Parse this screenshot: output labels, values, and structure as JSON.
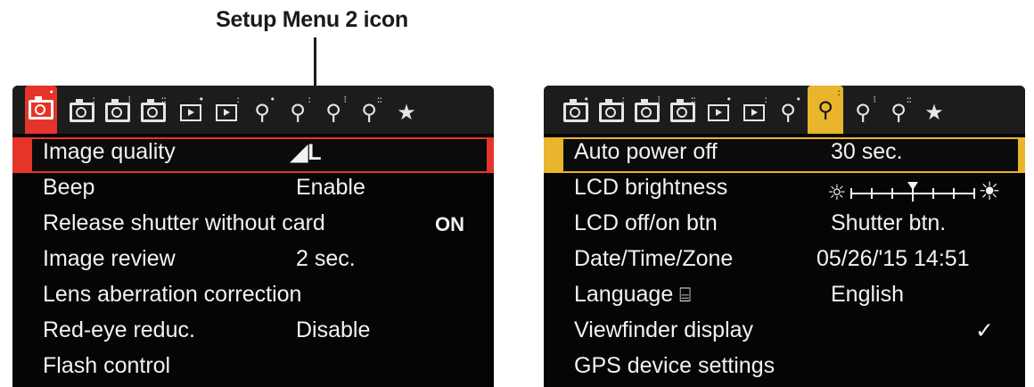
{
  "caption": "Setup Menu 2 icon",
  "colors": {
    "left_accent": "#e5342a",
    "right_accent": "#e8b52c",
    "screen_bg": "#050505",
    "text": "#f2f2f2"
  },
  "left_screen": {
    "tabs": [
      {
        "icon": "camera-icon",
        "dots": "•",
        "active": true
      },
      {
        "icon": "camera-icon",
        "dots": "••"
      },
      {
        "icon": "camera-icon",
        "dots": "•••"
      },
      {
        "icon": "camera-icon",
        "dots": "••••"
      },
      {
        "icon": "playback-icon",
        "dots": "•"
      },
      {
        "icon": "playback-icon",
        "dots": "••"
      },
      {
        "icon": "wrench-icon",
        "dots": "•"
      },
      {
        "icon": "wrench-icon",
        "dots": "••"
      },
      {
        "icon": "wrench-icon",
        "dots": "•••"
      },
      {
        "icon": "wrench-icon",
        "dots": "••••"
      },
      {
        "icon": "star-icon",
        "dots": ""
      }
    ],
    "items": [
      {
        "label": "Image quality",
        "value": "◢L",
        "selected": true
      },
      {
        "label": "Beep",
        "value": "Enable"
      },
      {
        "label": "Release shutter without card",
        "value": "ON"
      },
      {
        "label": "Image review",
        "value": "2 sec."
      },
      {
        "label": "Lens aberration correction",
        "value": ""
      },
      {
        "label": "Red-eye reduc.",
        "value": "Disable"
      },
      {
        "label": "Flash control",
        "value": ""
      }
    ]
  },
  "right_screen": {
    "items": [
      {
        "label": "Auto power off",
        "value": "30 sec.",
        "selected": true
      },
      {
        "label": "LCD brightness",
        "value": ""
      },
      {
        "label": "LCD off/on btn",
        "value": "Shutter btn."
      },
      {
        "label": "Date/Time/Zone",
        "value": "05/26/'15 14:51"
      },
      {
        "label": "Language",
        "value": "English"
      },
      {
        "label": "Viewfinder display",
        "value": "✓"
      },
      {
        "label": "GPS device settings",
        "value": ""
      }
    ],
    "brightness_level": 0.5
  }
}
